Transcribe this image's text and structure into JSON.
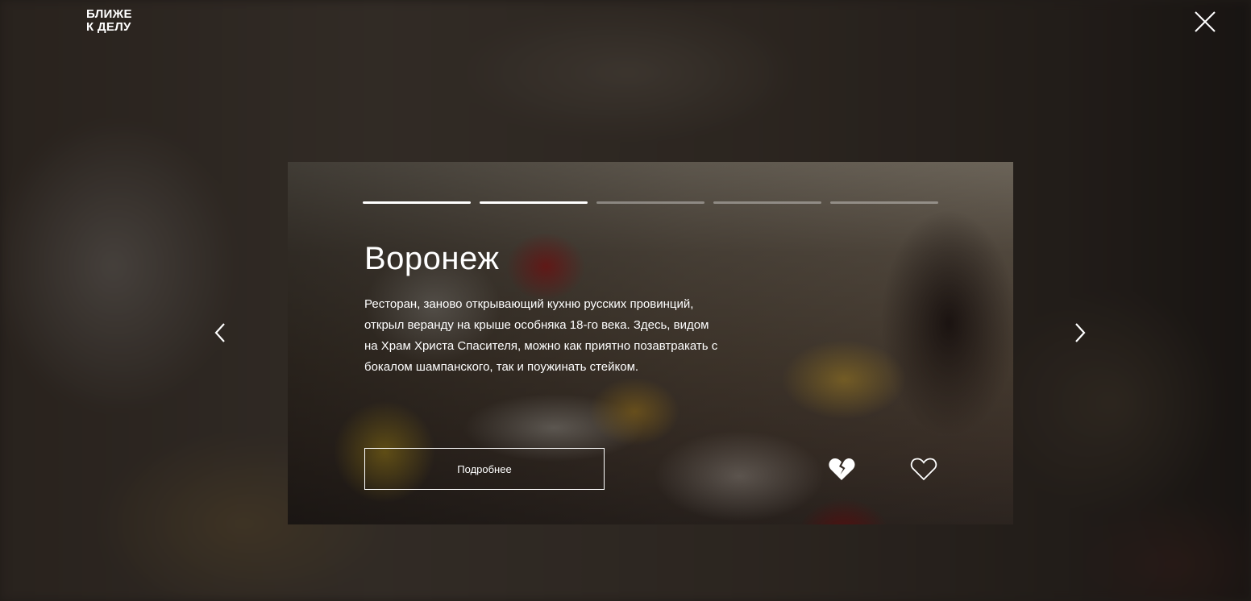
{
  "brand": {
    "logo_line1": "БЛИЖЕ",
    "logo_line2": "К ДЕЛУ"
  },
  "story": {
    "title": "Воронеж",
    "description": "Ресторан, заново открывающий кухню русских провинций, открыл веранду на крыше особняка 18-го века. Здесь, видом на Храм Христа Спасителя, можно как приятно позавтракать с бокалом шампанского, так и поужинать стейком.",
    "more_label": "Подробнее",
    "progress": {
      "total": 5,
      "active": 2
    }
  },
  "icons": {
    "close": "close-icon",
    "prev": "chevron-left-icon",
    "next": "chevron-right-icon",
    "dislike": "broken-heart-icon",
    "like": "heart-outline-icon"
  },
  "colors": {
    "text": "#ffffff",
    "progress_inactive": "rgba(255,255,255,0.35)"
  }
}
